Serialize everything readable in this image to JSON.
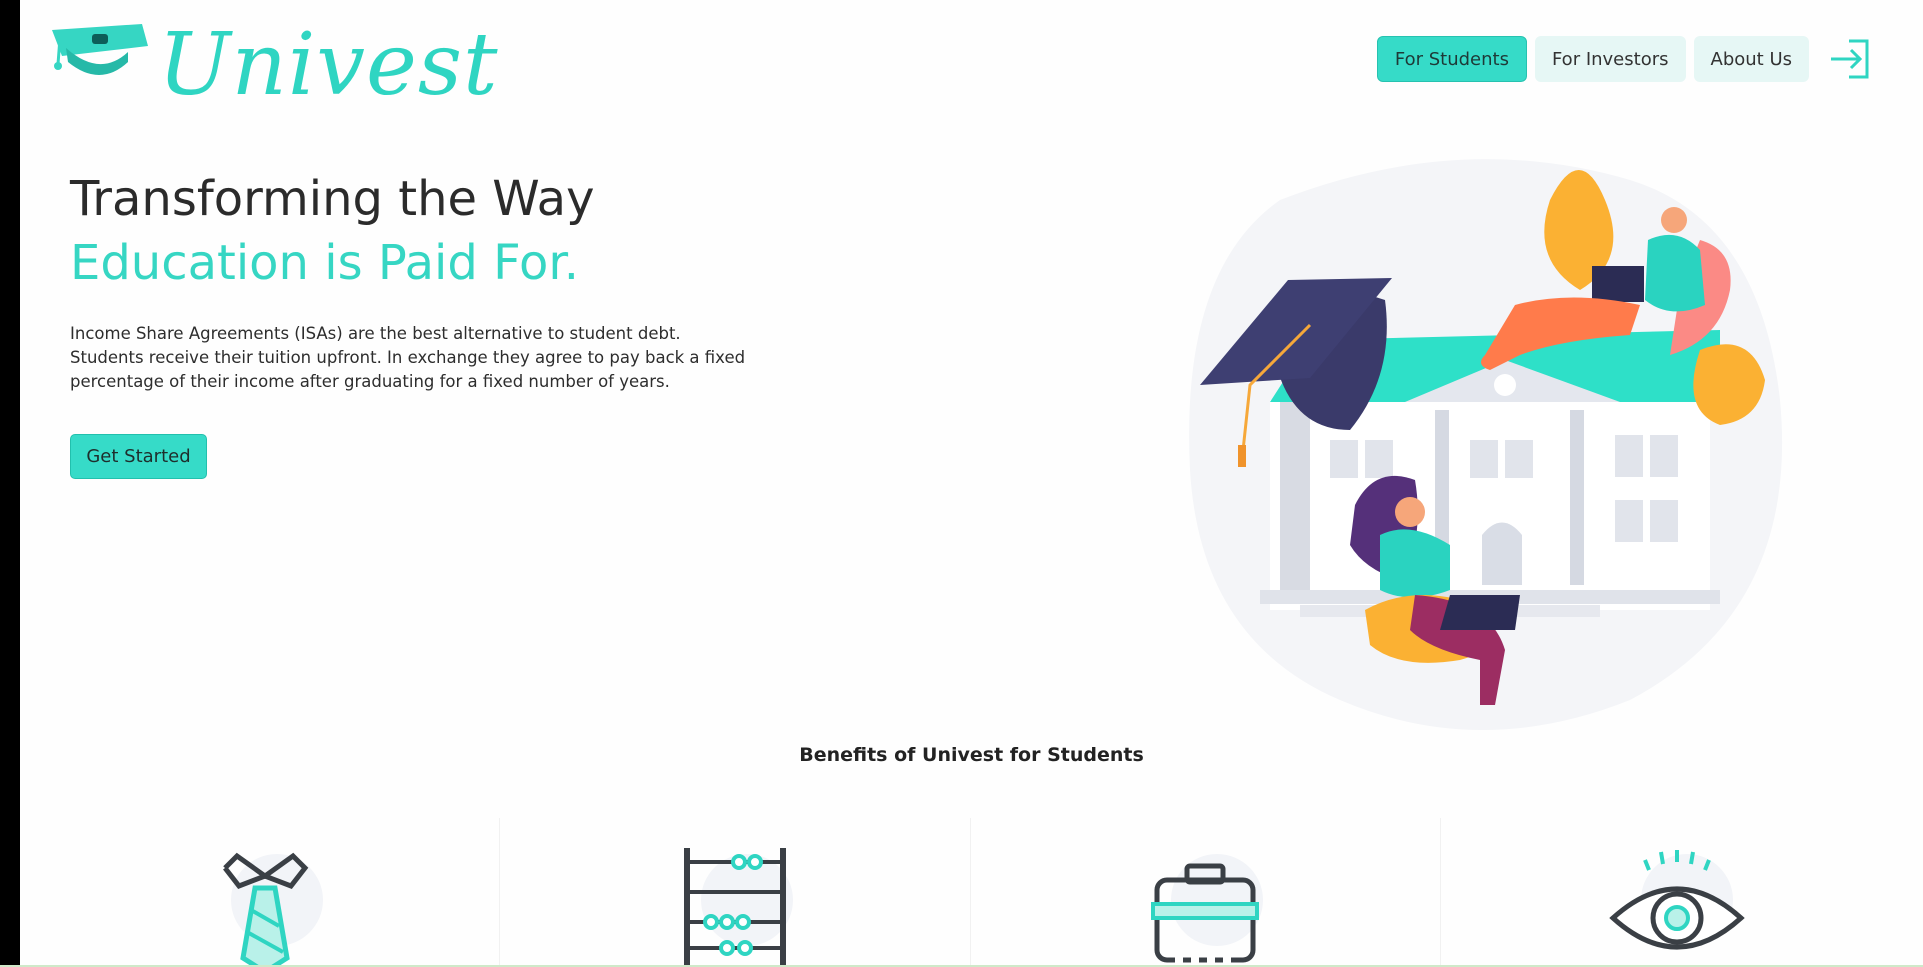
{
  "app": {
    "brand": "Univest"
  },
  "nav": {
    "items": [
      {
        "label": "For Students",
        "active": true
      },
      {
        "label": "For Investors",
        "active": false
      },
      {
        "label": "About Us",
        "active": false
      }
    ],
    "login_icon": "login-arrow-icon"
  },
  "hero": {
    "title_line1": "Transforming the Way",
    "title_line2": "Education is Paid For.",
    "description": "Income Share Agreements (ISAs) are the best alternative to student debt. Students receive their tuition upfront. In exchange they agree to pay back a fixed percentage of their income after graduating for a fixed number of years.",
    "cta_label": "Get Started"
  },
  "benefits": {
    "heading": "Benefits of Univest for Students",
    "icons": [
      "tie-icon",
      "abacus-icon",
      "briefcase-icon",
      "eye-icon"
    ]
  },
  "colors": {
    "accent": "#36dbc8",
    "accent_dark": "#22c0ad",
    "text": "#2b2b2b",
    "nav_bg": "#e6f7f5"
  }
}
